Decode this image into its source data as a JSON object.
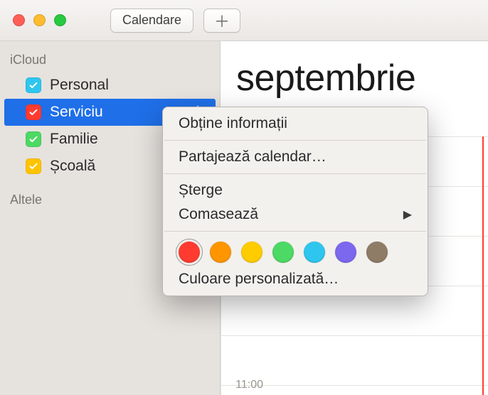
{
  "toolbar": {
    "calendars_label": "Calendare"
  },
  "sidebar": {
    "groups": [
      {
        "label": "iCloud",
        "items": [
          {
            "label": "Personal",
            "color": "#2ec6ef",
            "selected": false
          },
          {
            "label": "Serviciu",
            "color": "#ff3b30",
            "selected": true
          },
          {
            "label": "Familie",
            "color": "#4cd964",
            "selected": false
          },
          {
            "label": "Școală",
            "color": "#ffc400",
            "selected": false
          }
        ]
      },
      {
        "label": "Altele",
        "items": []
      }
    ]
  },
  "main": {
    "month": "septembrie",
    "time_label": "11:00"
  },
  "context_menu": {
    "get_info": "Obține informații",
    "share": "Partajează calendar…",
    "delete": "Șterge",
    "merge": "Comasează",
    "custom_color": "Culoare personalizată…",
    "colors": [
      "#ff3b30",
      "#ff9500",
      "#ffcc00",
      "#4cd964",
      "#2ec6ef",
      "#7b68ee",
      "#8e7c66"
    ],
    "selected_color_index": 0
  }
}
